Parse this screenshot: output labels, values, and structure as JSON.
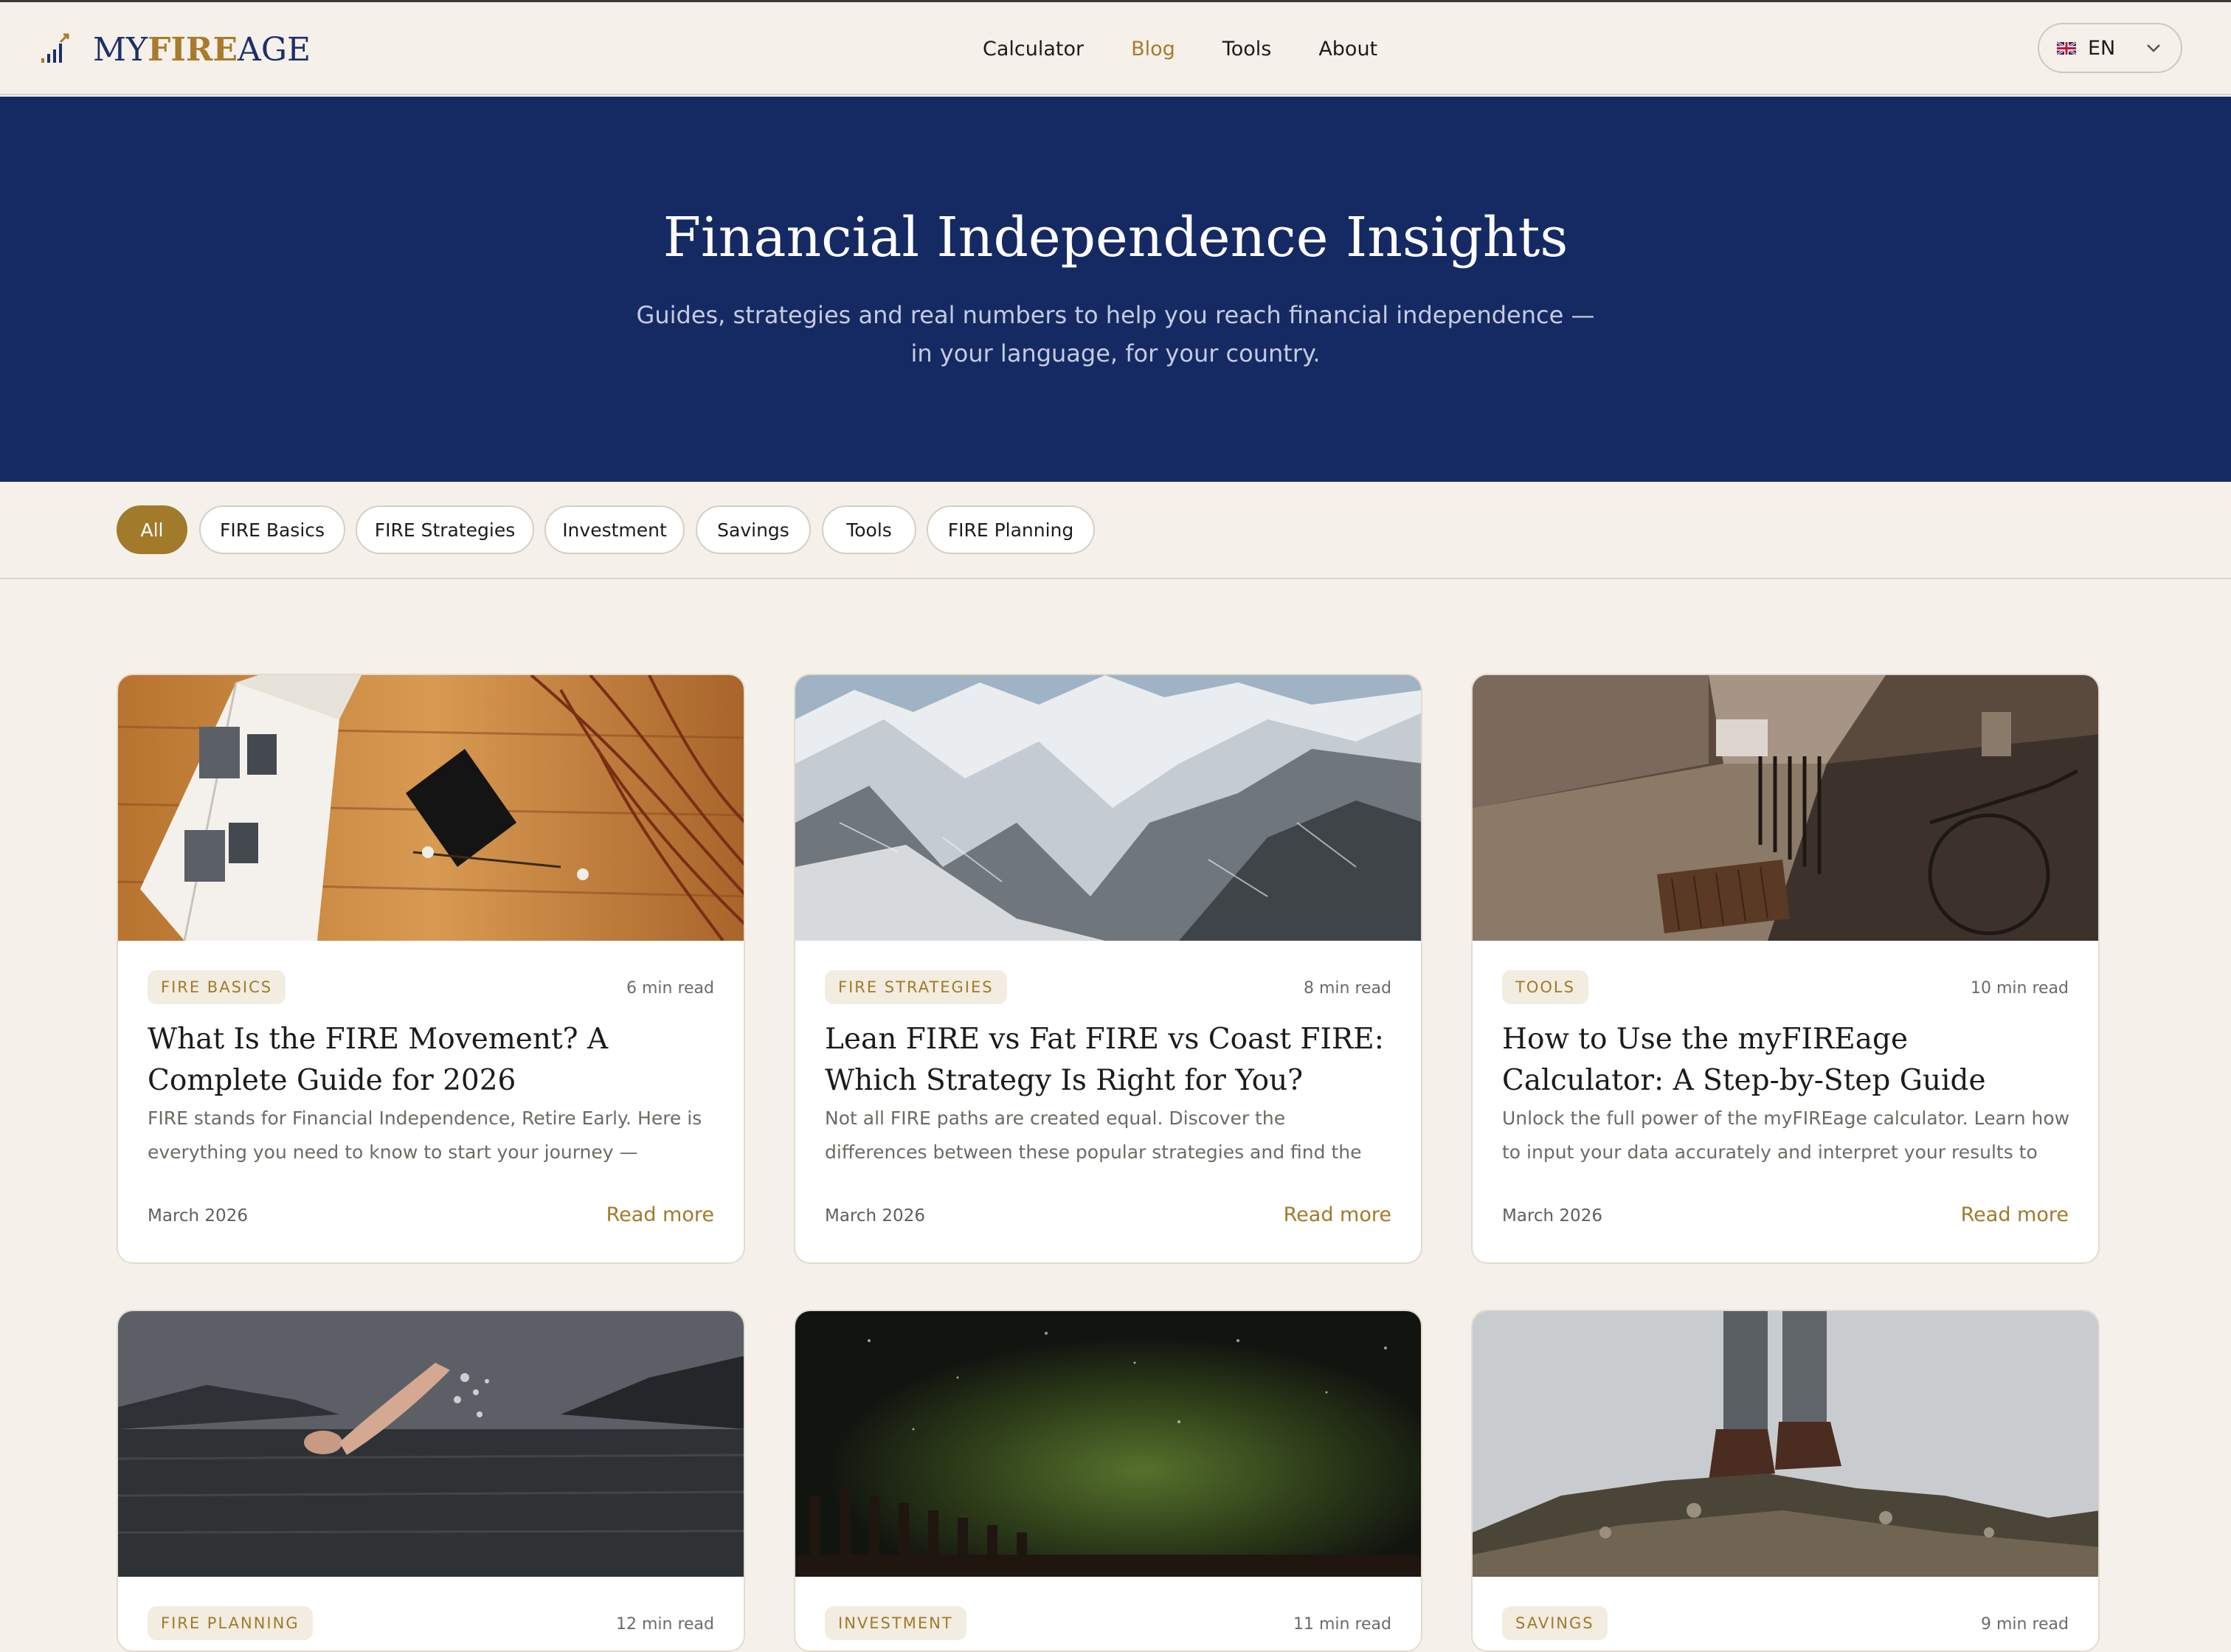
{
  "header": {
    "logo": {
      "my": "MY",
      "fire": "FIRE",
      "age": "AGE"
    },
    "nav": [
      "Calculator",
      "Blog",
      "Tools",
      "About"
    ],
    "active_nav": "Blog",
    "language": "EN"
  },
  "hero": {
    "title": "Financial Independence Insights",
    "subtitle": "Guides, strategies and real numbers to help you reach financial independence — in your language, for your country."
  },
  "filters": [
    "All",
    "FIRE Basics",
    "FIRE Strategies",
    "Investment",
    "Savings",
    "Tools",
    "FIRE Planning"
  ],
  "active_filter": "All",
  "colors": {
    "navy": "#152a63",
    "gold": "#a17a2a",
    "background": "#f5f1ea"
  },
  "cards": [
    {
      "tag": "FIRE BASICS",
      "read_time": "6 min read",
      "title": "What Is the FIRE Movement? A Complete Guide for 2026",
      "excerpt": "FIRE stands for Financial Independence, Retire Early. Here is everything you need to know to start your journey — regardless...",
      "date": "March 2026",
      "cta": "Read more"
    },
    {
      "tag": "FIRE STRATEGIES",
      "read_time": "8 min read",
      "title": "Lean FIRE vs Fat FIRE vs Coast FIRE: Which Strategy Is Right for You?",
      "excerpt": "Not all FIRE paths are created equal. Discover the differences between these popular strategies and find the one that fits your...",
      "date": "March 2026",
      "cta": "Read more"
    },
    {
      "tag": "TOOLS",
      "read_time": "10 min read",
      "title": "How to Use the myFIREage Calculator: A Step-by-Step Guide",
      "excerpt": "Unlock the full power of the myFIREage calculator. Learn how to input your data accurately and interpret your results to accelera...",
      "date": "March 2026",
      "cta": "Read more"
    },
    {
      "tag": "FIRE PLANNING",
      "read_time": "12 min read"
    },
    {
      "tag": "INVESTMENT",
      "read_time": "11 min read"
    },
    {
      "tag": "SAVINGS",
      "read_time": "9 min read"
    }
  ]
}
